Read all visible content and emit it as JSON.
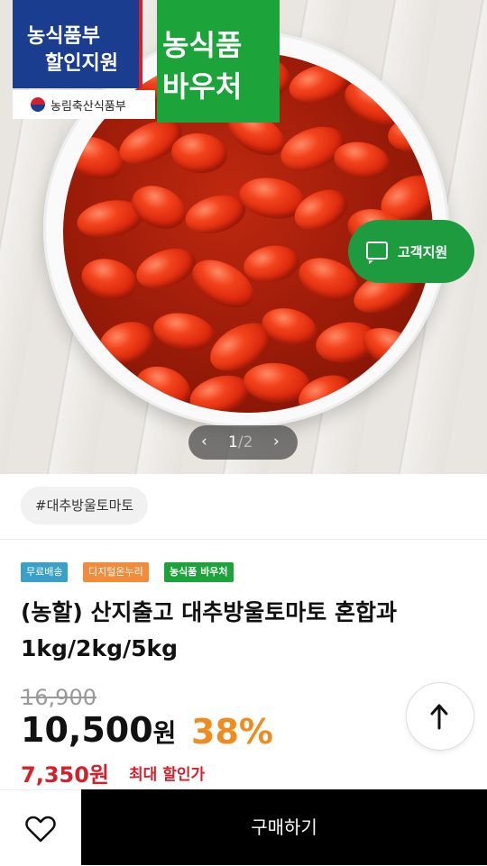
{
  "banner": {
    "badge_blue_line1": "농식품부",
    "badge_blue_line2": "할인지원",
    "ministry": "농림축산식품부",
    "badge_green_line1": "농식품",
    "badge_green_line2": "바우처"
  },
  "support_button": {
    "label": "고객지원",
    "icon": "chat-icon"
  },
  "gallery": {
    "current": "1",
    "separator": "/",
    "total": "2"
  },
  "hashtag": "#대추방울토마토",
  "chips": [
    {
      "label": "무료배송",
      "color": "#3aa0c9"
    },
    {
      "label": "디지털온누리",
      "color": "#f08c3c"
    },
    {
      "label": "농식품 바우처",
      "color": "#1ca33a"
    }
  ],
  "product": {
    "title": "(농할) 산지출고 대추방울토마토 혼합과 1kg/2kg/5kg",
    "original_price": "16,900",
    "price": "10,500",
    "currency": "원",
    "discount_rate": "38%",
    "max_discount_price": "7,350원",
    "max_discount_label": "최대 할인가"
  },
  "bottom_bar": {
    "buy_label": "구매하기",
    "wish_icon": "heart-icon"
  },
  "colors": {
    "accent_green": "#1ca33a",
    "discount_orange": "#f08c1d",
    "price_red": "#d71f2b"
  }
}
